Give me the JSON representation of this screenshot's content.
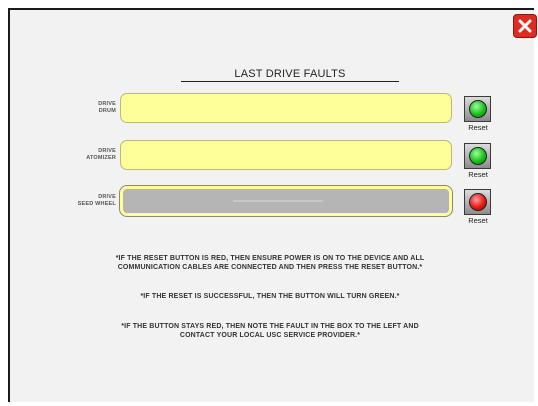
{
  "dialog": {
    "title": "LAST DRIVE FAULTS",
    "close_icon": "close-icon"
  },
  "drives": [
    {
      "label_line1": "DRIVE",
      "label_line2": "DRUM",
      "status": "green",
      "reset_label": "Reset",
      "fault_text": ""
    },
    {
      "label_line1": "DRIVE",
      "label_line2": "ATOMIZER",
      "status": "green",
      "reset_label": "Reset",
      "fault_text": ""
    },
    {
      "label_line1": "DRIVE",
      "label_line2": "SEED WHEEL",
      "status": "red",
      "reset_label": "Reset",
      "fault_text": ""
    }
  ],
  "notes": {
    "note1_line1": "*IF THE RESET BUTTON IS RED, THEN ENSURE POWER IS ON TO THE DEVICE AND ALL",
    "note1_line2": "COMMUNICATION CABLES ARE CONNECTED AND THEN PRESS THE RESET BUTTON.*",
    "note2": "*IF THE RESET IS SUCCESSFUL, THEN THE BUTTON WILL TURN GREEN.*",
    "note3_line1": "*IF THE BUTTON STAYS RED, THEN NOTE THE FAULT IN THE BOX TO THE LEFT AND",
    "note3_line2": "CONTACT YOUR LOCAL USC SERVICE PROVIDER.*"
  },
  "colors": {
    "close": "#e02b20",
    "fault_box": "#ffff99",
    "ok": "#18c018",
    "fault": "#e81818"
  }
}
